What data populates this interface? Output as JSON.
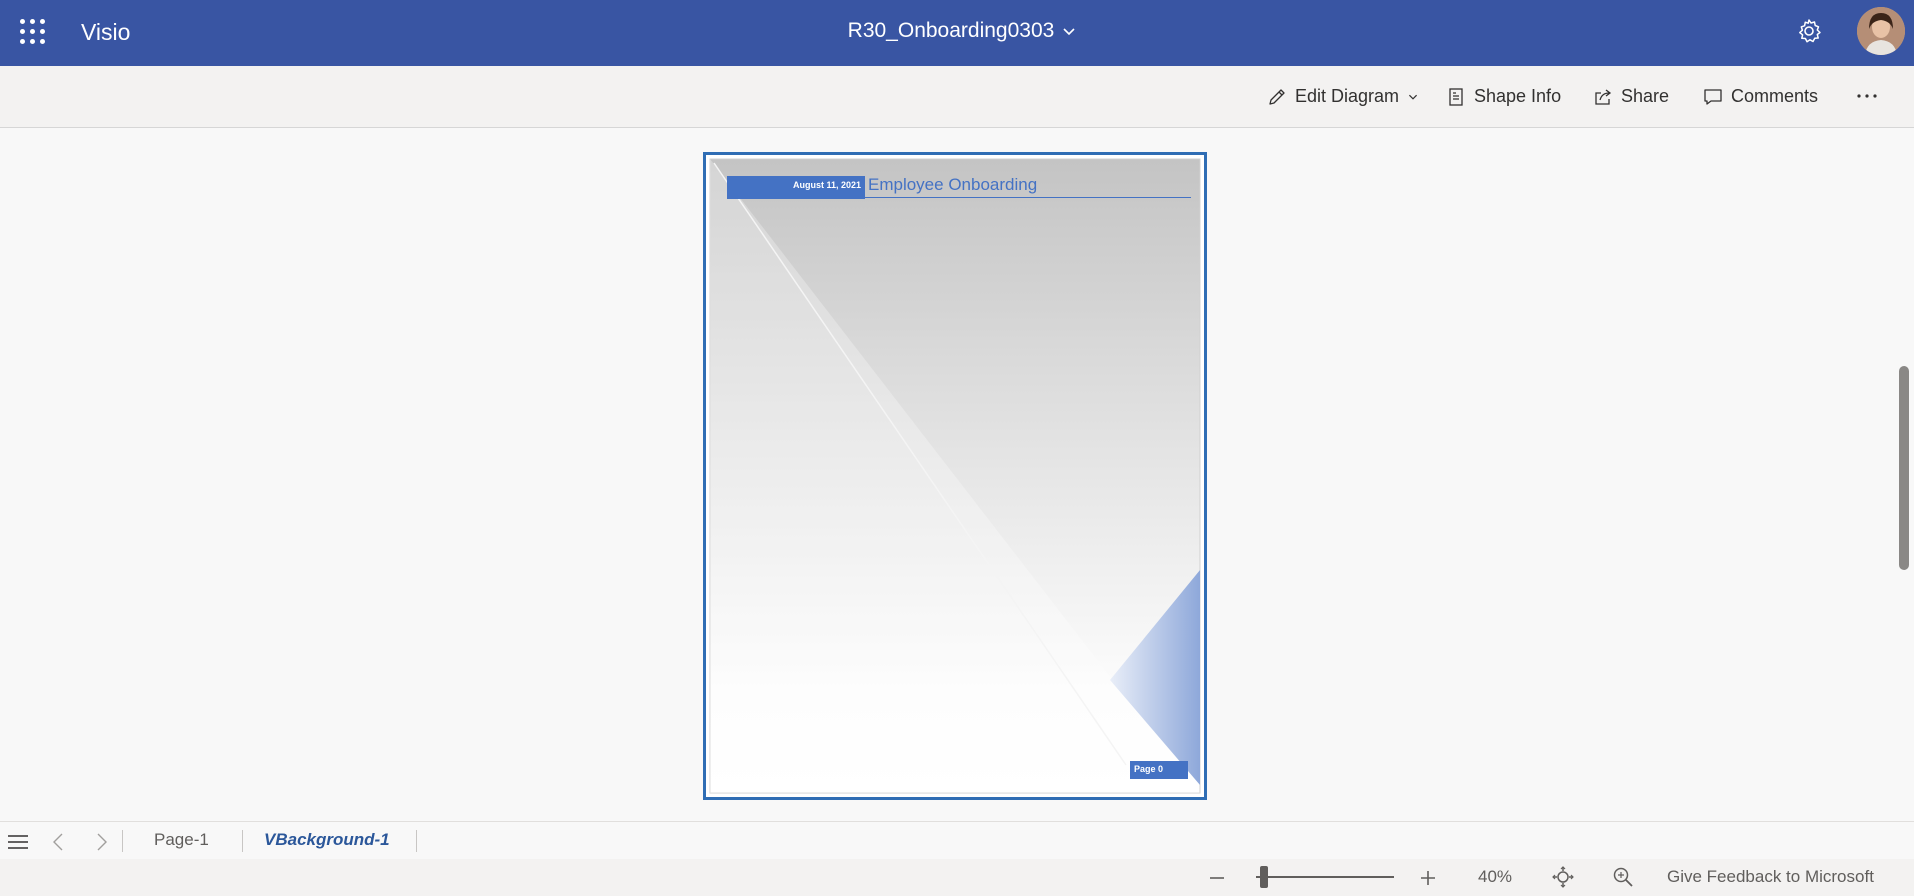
{
  "topbar": {
    "app_name": "Visio",
    "document_title": "R30_Onboarding0303",
    "bg_color": "#3955a3"
  },
  "icons": {
    "waffle": "app-launcher-icon",
    "title_chevron": "chevron-down-icon",
    "settings": "gear-icon",
    "avatar": "user-avatar"
  },
  "commandbar": {
    "edit_diagram": "Edit Diagram",
    "shape_info": "Shape Info",
    "share": "Share",
    "comments": "Comments"
  },
  "diagram": {
    "date": "August 11, 2021",
    "title": "Employee Onboarding",
    "page_label": "Page 0",
    "accent_color": "#4472c4",
    "frame_color": "#2f6db4"
  },
  "tabs": {
    "items": [
      {
        "label": "Page-1",
        "active": false
      },
      {
        "label": "VBackground-1",
        "active": true
      }
    ]
  },
  "statusbar": {
    "zoom": "40%",
    "feedback": "Give Feedback to Microsoft"
  }
}
